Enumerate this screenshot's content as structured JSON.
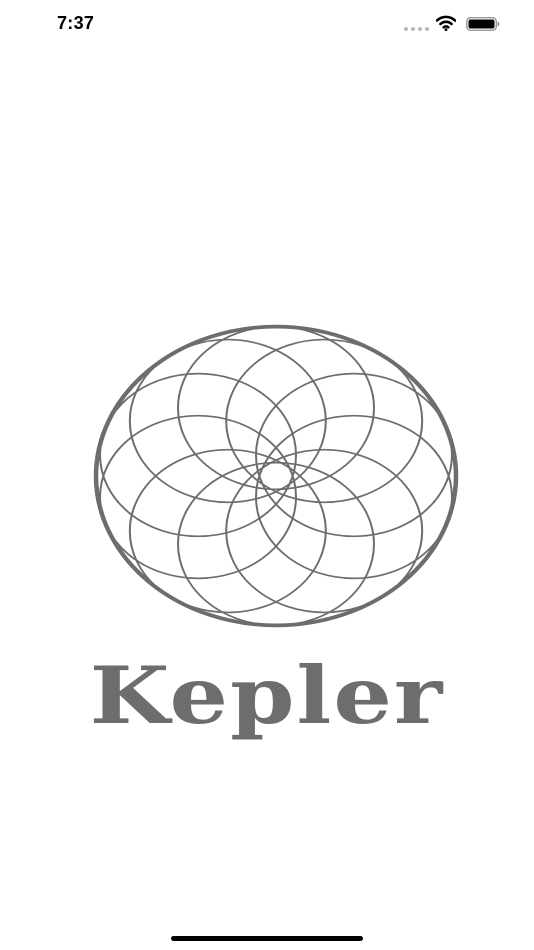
{
  "status_bar": {
    "time": "7:37",
    "icons": [
      "signal-icon",
      "wifi-icon",
      "battery-icon"
    ]
  },
  "splash": {
    "brand_name": "Kepler",
    "logo_icon": "rosette-ellipse-logo",
    "logo_color": "#6d6d70"
  },
  "home_indicator": {
    "color": "#000000"
  }
}
